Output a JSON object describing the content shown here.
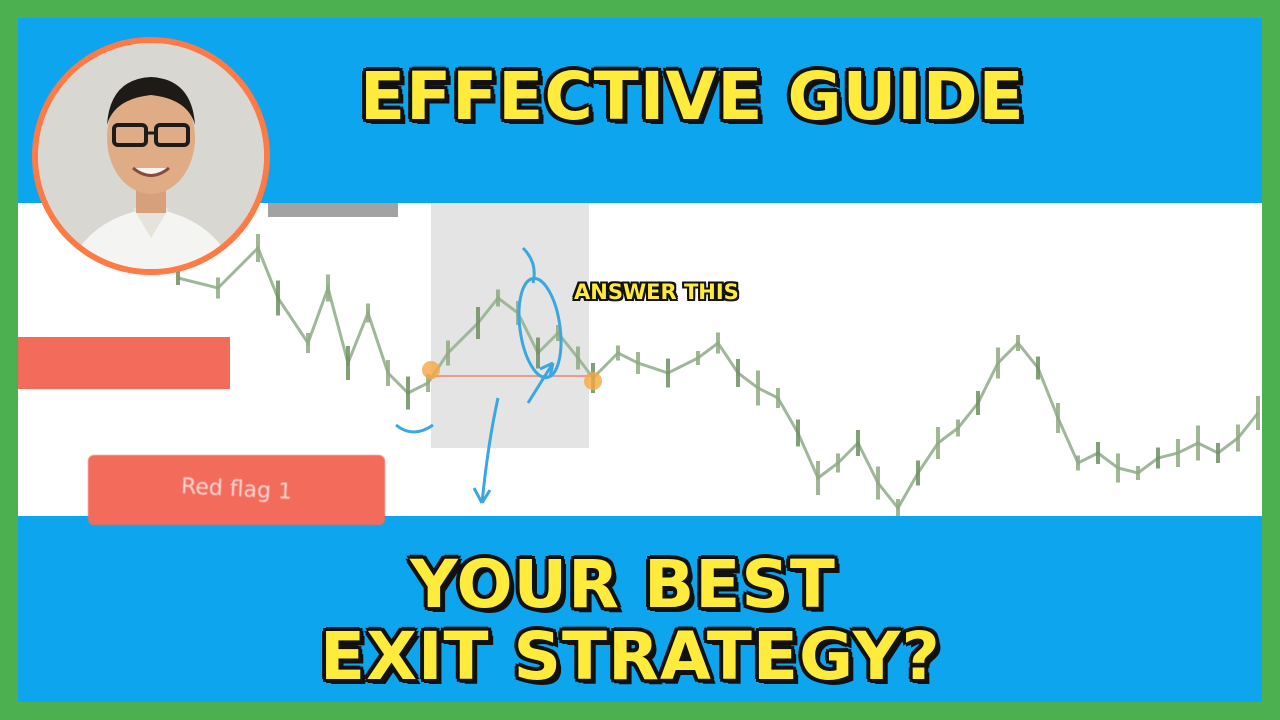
{
  "header": {
    "title": "EFFECTIVE GUIDE"
  },
  "footer": {
    "line1": "YOUR BEST",
    "line2": "EXIT STRATEGY?"
  },
  "annotations": {
    "answer": "ANSWER THIS",
    "red_flag": "Red flag 1"
  },
  "colors": {
    "outer_border": "#4CAF50",
    "background": "#0EA5EF",
    "headline_text": "#FFEB3B",
    "headline_outline": "#111111",
    "avatar_ring": "#FF7A45",
    "red_flag": "#F26B5B",
    "pen": "#3BA7E0"
  },
  "icons": {
    "avatar": "presenter-portrait"
  }
}
